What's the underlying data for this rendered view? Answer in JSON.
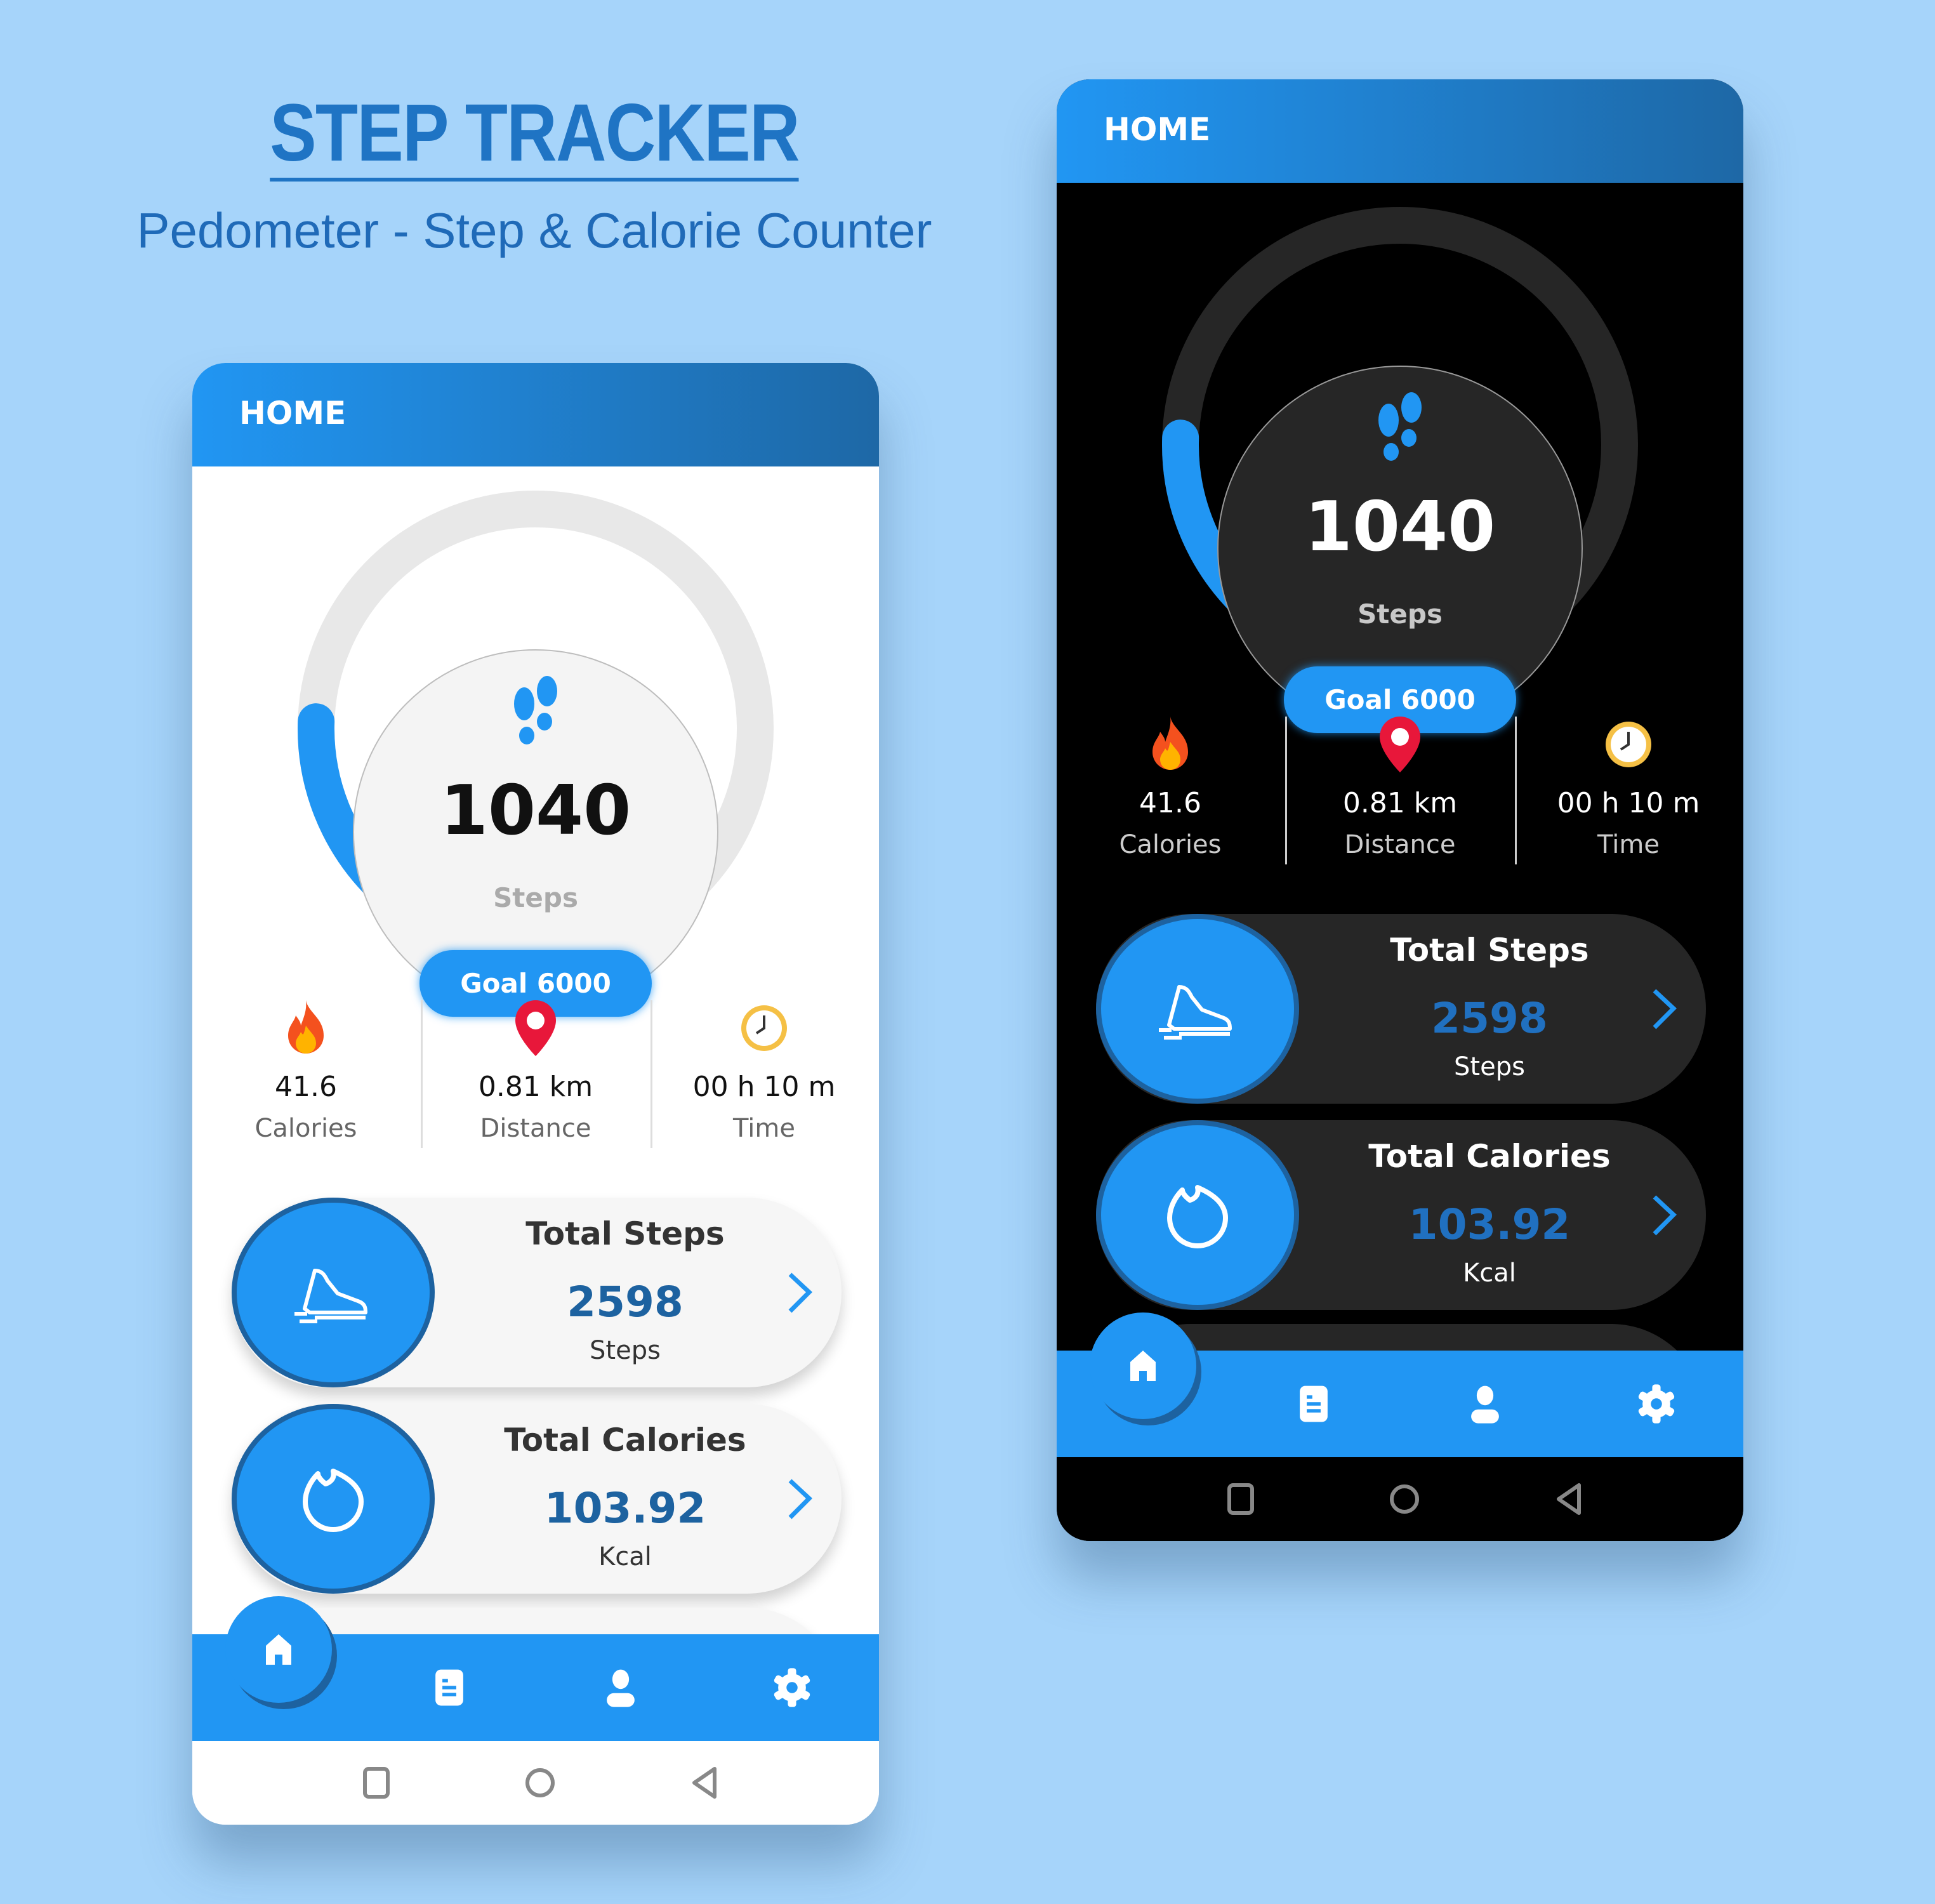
{
  "promo": {
    "title": "STEP TRACKER",
    "subtitle": "Pedometer - Step & Calorie Counter"
  },
  "app": {
    "header_title": "HOME",
    "steps": "1040",
    "steps_label": "Steps",
    "goal_label": "Goal 6000",
    "progress_fraction": 0.1733,
    "stats": [
      {
        "value": "41.6",
        "label": "Calories",
        "icon": "fire-icon"
      },
      {
        "value": "0.81 km",
        "label": "Distance",
        "icon": "location-pin-icon"
      },
      {
        "value": "00 h 10 m",
        "label": "Time",
        "icon": "clock-icon"
      }
    ],
    "cards": [
      {
        "title": "Total Steps",
        "value": "2598",
        "unit": "Steps",
        "icon": "shoe-icon"
      },
      {
        "title": "Total Calories",
        "value": "103.92",
        "unit": "Kcal",
        "icon": "flame-outline-icon"
      }
    ],
    "nav": [
      "home-icon",
      "report-icon",
      "profile-icon",
      "settings-icon"
    ],
    "system_nav": [
      "recents-icon",
      "home-circle-icon",
      "back-icon"
    ]
  },
  "colors": {
    "accent": "#2196f3",
    "accent_dark": "#1d62a0",
    "background": "#a6d4fa",
    "dark_surface": "#262626"
  }
}
